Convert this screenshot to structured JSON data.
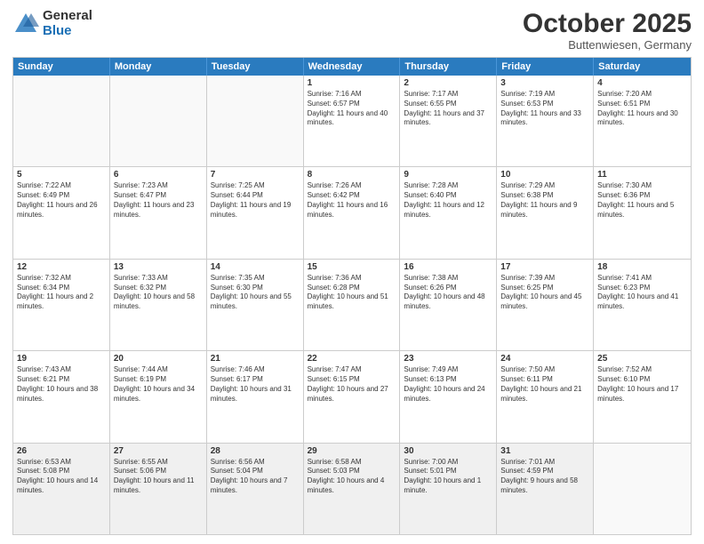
{
  "logo": {
    "general": "General",
    "blue": "Blue"
  },
  "title": "October 2025",
  "location": "Buttenwiesen, Germany",
  "days": [
    "Sunday",
    "Monday",
    "Tuesday",
    "Wednesday",
    "Thursday",
    "Friday",
    "Saturday"
  ],
  "rows": [
    [
      {
        "day": "",
        "text": ""
      },
      {
        "day": "",
        "text": ""
      },
      {
        "day": "",
        "text": ""
      },
      {
        "day": "1",
        "text": "Sunrise: 7:16 AM\nSunset: 6:57 PM\nDaylight: 11 hours and 40 minutes."
      },
      {
        "day": "2",
        "text": "Sunrise: 7:17 AM\nSunset: 6:55 PM\nDaylight: 11 hours and 37 minutes."
      },
      {
        "day": "3",
        "text": "Sunrise: 7:19 AM\nSunset: 6:53 PM\nDaylight: 11 hours and 33 minutes."
      },
      {
        "day": "4",
        "text": "Sunrise: 7:20 AM\nSunset: 6:51 PM\nDaylight: 11 hours and 30 minutes."
      }
    ],
    [
      {
        "day": "5",
        "text": "Sunrise: 7:22 AM\nSunset: 6:49 PM\nDaylight: 11 hours and 26 minutes."
      },
      {
        "day": "6",
        "text": "Sunrise: 7:23 AM\nSunset: 6:47 PM\nDaylight: 11 hours and 23 minutes."
      },
      {
        "day": "7",
        "text": "Sunrise: 7:25 AM\nSunset: 6:44 PM\nDaylight: 11 hours and 19 minutes."
      },
      {
        "day": "8",
        "text": "Sunrise: 7:26 AM\nSunset: 6:42 PM\nDaylight: 11 hours and 16 minutes."
      },
      {
        "day": "9",
        "text": "Sunrise: 7:28 AM\nSunset: 6:40 PM\nDaylight: 11 hours and 12 minutes."
      },
      {
        "day": "10",
        "text": "Sunrise: 7:29 AM\nSunset: 6:38 PM\nDaylight: 11 hours and 9 minutes."
      },
      {
        "day": "11",
        "text": "Sunrise: 7:30 AM\nSunset: 6:36 PM\nDaylight: 11 hours and 5 minutes."
      }
    ],
    [
      {
        "day": "12",
        "text": "Sunrise: 7:32 AM\nSunset: 6:34 PM\nDaylight: 11 hours and 2 minutes."
      },
      {
        "day": "13",
        "text": "Sunrise: 7:33 AM\nSunset: 6:32 PM\nDaylight: 10 hours and 58 minutes."
      },
      {
        "day": "14",
        "text": "Sunrise: 7:35 AM\nSunset: 6:30 PM\nDaylight: 10 hours and 55 minutes."
      },
      {
        "day": "15",
        "text": "Sunrise: 7:36 AM\nSunset: 6:28 PM\nDaylight: 10 hours and 51 minutes."
      },
      {
        "day": "16",
        "text": "Sunrise: 7:38 AM\nSunset: 6:26 PM\nDaylight: 10 hours and 48 minutes."
      },
      {
        "day": "17",
        "text": "Sunrise: 7:39 AM\nSunset: 6:25 PM\nDaylight: 10 hours and 45 minutes."
      },
      {
        "day": "18",
        "text": "Sunrise: 7:41 AM\nSunset: 6:23 PM\nDaylight: 10 hours and 41 minutes."
      }
    ],
    [
      {
        "day": "19",
        "text": "Sunrise: 7:43 AM\nSunset: 6:21 PM\nDaylight: 10 hours and 38 minutes."
      },
      {
        "day": "20",
        "text": "Sunrise: 7:44 AM\nSunset: 6:19 PM\nDaylight: 10 hours and 34 minutes."
      },
      {
        "day": "21",
        "text": "Sunrise: 7:46 AM\nSunset: 6:17 PM\nDaylight: 10 hours and 31 minutes."
      },
      {
        "day": "22",
        "text": "Sunrise: 7:47 AM\nSunset: 6:15 PM\nDaylight: 10 hours and 27 minutes."
      },
      {
        "day": "23",
        "text": "Sunrise: 7:49 AM\nSunset: 6:13 PM\nDaylight: 10 hours and 24 minutes."
      },
      {
        "day": "24",
        "text": "Sunrise: 7:50 AM\nSunset: 6:11 PM\nDaylight: 10 hours and 21 minutes."
      },
      {
        "day": "25",
        "text": "Sunrise: 7:52 AM\nSunset: 6:10 PM\nDaylight: 10 hours and 17 minutes."
      }
    ],
    [
      {
        "day": "26",
        "text": "Sunrise: 6:53 AM\nSunset: 5:08 PM\nDaylight: 10 hours and 14 minutes."
      },
      {
        "day": "27",
        "text": "Sunrise: 6:55 AM\nSunset: 5:06 PM\nDaylight: 10 hours and 11 minutes."
      },
      {
        "day": "28",
        "text": "Sunrise: 6:56 AM\nSunset: 5:04 PM\nDaylight: 10 hours and 7 minutes."
      },
      {
        "day": "29",
        "text": "Sunrise: 6:58 AM\nSunset: 5:03 PM\nDaylight: 10 hours and 4 minutes."
      },
      {
        "day": "30",
        "text": "Sunrise: 7:00 AM\nSunset: 5:01 PM\nDaylight: 10 hours and 1 minute."
      },
      {
        "day": "31",
        "text": "Sunrise: 7:01 AM\nSunset: 4:59 PM\nDaylight: 9 hours and 58 minutes."
      },
      {
        "day": "",
        "text": ""
      }
    ]
  ]
}
